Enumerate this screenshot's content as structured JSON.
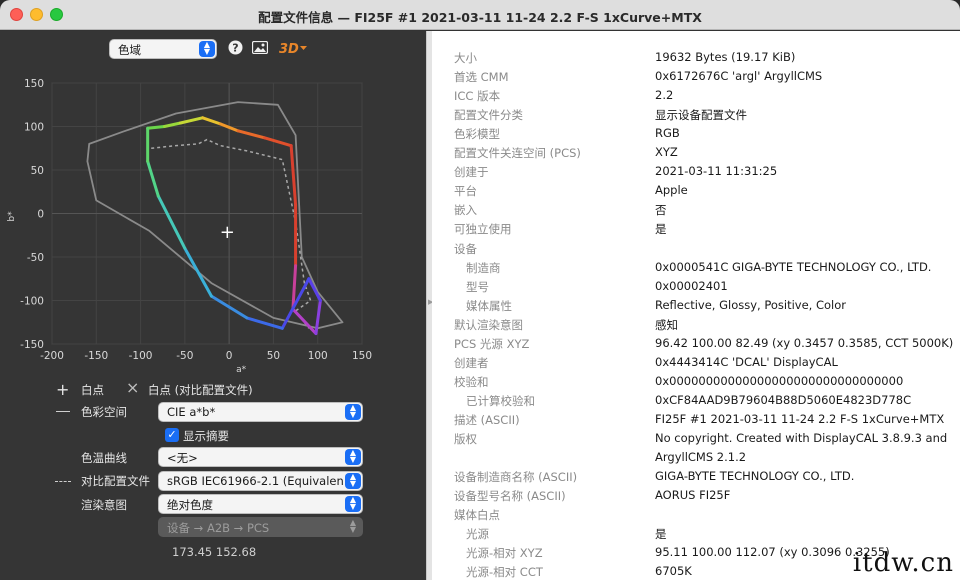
{
  "window": {
    "title": "配置文件信息 — FI25F #1 2021-03-11 11-24 2.2 F-S 1xCurve+MTX"
  },
  "toolbar": {
    "view_select": "色域",
    "help_icon": "question-circle-icon",
    "image_icon": "image-icon",
    "view3d_label": "3D"
  },
  "chart_data": {
    "type": "scatter",
    "title": "",
    "xlabel": "a*",
    "ylabel": "b*",
    "xlim": [
      -200,
      150
    ],
    "ylim": [
      -150,
      150
    ],
    "xticks": [
      -200,
      -150,
      -100,
      -50,
      0,
      50,
      100,
      150
    ],
    "yticks": [
      -150,
      -100,
      -50,
      0,
      50,
      100,
      150
    ],
    "grid": true,
    "series": [
      {
        "style": "gray-outline",
        "points": [
          [
            -158,
            80
          ],
          [
            -120,
            94
          ],
          [
            -60,
            115
          ],
          [
            10,
            128
          ],
          [
            55,
            125
          ],
          [
            75,
            90
          ],
          [
            82,
            -50
          ],
          [
            100,
            -90
          ],
          [
            128,
            -125
          ],
          [
            100,
            -132
          ],
          [
            50,
            -120
          ],
          [
            -20,
            -80
          ],
          [
            -90,
            -20
          ],
          [
            -150,
            15
          ],
          [
            -160,
            60
          ],
          [
            -158,
            80
          ]
        ]
      },
      {
        "style": "gradient-gamut",
        "points": [
          [
            -92,
            98
          ],
          [
            -73,
            100
          ],
          [
            -55,
            104
          ],
          [
            -30,
            110
          ],
          [
            -10,
            103
          ],
          [
            10,
            95
          ],
          [
            40,
            87
          ],
          [
            70,
            78
          ],
          [
            75,
            10
          ],
          [
            75,
            -60
          ],
          [
            72,
            -110
          ],
          [
            98,
            -138
          ],
          [
            103,
            -100
          ],
          [
            90,
            -75
          ],
          [
            60,
            -132
          ],
          [
            20,
            -120
          ],
          [
            -20,
            -95
          ],
          [
            -50,
            -40
          ],
          [
            -80,
            20
          ],
          [
            -92,
            60
          ],
          [
            -92,
            98
          ]
        ]
      },
      {
        "style": "dashed-gray",
        "points": [
          [
            -88,
            75
          ],
          [
            -60,
            78
          ],
          [
            -35,
            80
          ],
          [
            -25,
            85
          ],
          [
            -10,
            78
          ],
          [
            20,
            72
          ],
          [
            60,
            62
          ],
          [
            75,
            -10
          ],
          [
            85,
            -80
          ],
          [
            92,
            -100
          ],
          [
            75,
            -112
          ],
          [
            90,
            -132
          ]
        ]
      }
    ],
    "white_point": {
      "label": "+",
      "a": -2.1,
      "b": -21
    }
  },
  "legend": [
    {
      "marker": "+",
      "label": "白点"
    },
    {
      "marker": "×",
      "label": "白点 (对比配置文件)"
    }
  ],
  "controls": {
    "color_space_label": "色彩空间",
    "color_space_value": "CIE a*b*",
    "show_summary_label": "显示摘要",
    "tone_curve_label": "色温曲线",
    "tone_curve_value": "<无>",
    "compare_label": "对比配置文件",
    "compare_value": "sRGB IEC61966-2.1 (Equivalen…",
    "intent_label": "渲染意图",
    "intent_value": "绝对色度",
    "transform_value": "设备 → A2B → PCS",
    "coords": "173.45 152.68"
  },
  "info": [
    {
      "k": "大小",
      "v": "19632 Bytes (19.17 KiB)",
      "level": 0
    },
    {
      "k": "首选 CMM",
      "v": "0x6172676C 'argl' ArgyllCMS",
      "level": 0
    },
    {
      "k": "ICC 版本",
      "v": "2.2",
      "level": 0
    },
    {
      "k": "配置文件分类",
      "v": "显示设备配置文件",
      "level": 0
    },
    {
      "k": "色彩模型",
      "v": "RGB",
      "level": 0
    },
    {
      "k": "配置文件关连空间 (PCS)",
      "v": "XYZ",
      "level": 0
    },
    {
      "k": "创建于",
      "v": "2021-03-11 11:31:25",
      "level": 0
    },
    {
      "k": "平台",
      "v": "Apple",
      "level": 0
    },
    {
      "k": "嵌入",
      "v": "否",
      "level": 0
    },
    {
      "k": "可独立使用",
      "v": "是",
      "level": 0
    },
    {
      "k": "设备",
      "v": "",
      "level": 0
    },
    {
      "k": "制造商",
      "v": "0x0000541C GIGA-BYTE TECHNOLOGY CO., LTD.",
      "level": 1
    },
    {
      "k": "型号",
      "v": "0x00002401",
      "level": 1
    },
    {
      "k": "媒体属性",
      "v": "Reflective, Glossy, Positive, Color",
      "level": 1
    },
    {
      "k": "默认渲染意图",
      "v": "感知",
      "level": 0
    },
    {
      "k": "PCS 光源 XYZ",
      "v": "96.42 100.00  82.49 (xy 0.3457 0.3585, CCT 5000K)",
      "level": 0
    },
    {
      "k": "创建者",
      "v": "0x4443414C 'DCAL' DisplayCAL",
      "level": 0
    },
    {
      "k": "校验和",
      "v": "0x00000000000000000000000000000000",
      "level": 0
    },
    {
      "k": "已计算校验和",
      "v": "0xCF84AAD9B79604B88D5060E4823D778C",
      "level": 1
    },
    {
      "k": "描述 (ASCII)",
      "v": "FI25F #1 2021-03-11 11-24 2.2 F-S 1xCurve+MTX",
      "level": 0
    },
    {
      "k": "版权",
      "v": "No copyright. Created with DisplayCAL 3.8.9.3 and",
      "level": 0
    },
    {
      "k": "",
      "v": "ArgyllCMS 2.1.2",
      "level": 0
    },
    {
      "k": "设备制造商名称 (ASCII)",
      "v": "GIGA-BYTE TECHNOLOGY CO., LTD.",
      "level": 0
    },
    {
      "k": "设备型号名称 (ASCII)",
      "v": "AORUS FI25F",
      "level": 0
    },
    {
      "k": "媒体白点",
      "v": "",
      "level": 0
    },
    {
      "k": "光源",
      "v": "是",
      "level": 1
    },
    {
      "k": "光源-相对 XYZ",
      "v": "95.11 100.00 112.07 (xy 0.3096 0.3255)",
      "level": 1
    },
    {
      "k": "光源-相对 CCT",
      "v": "6705K",
      "level": 1
    }
  ],
  "watermark": "itdw.cn"
}
